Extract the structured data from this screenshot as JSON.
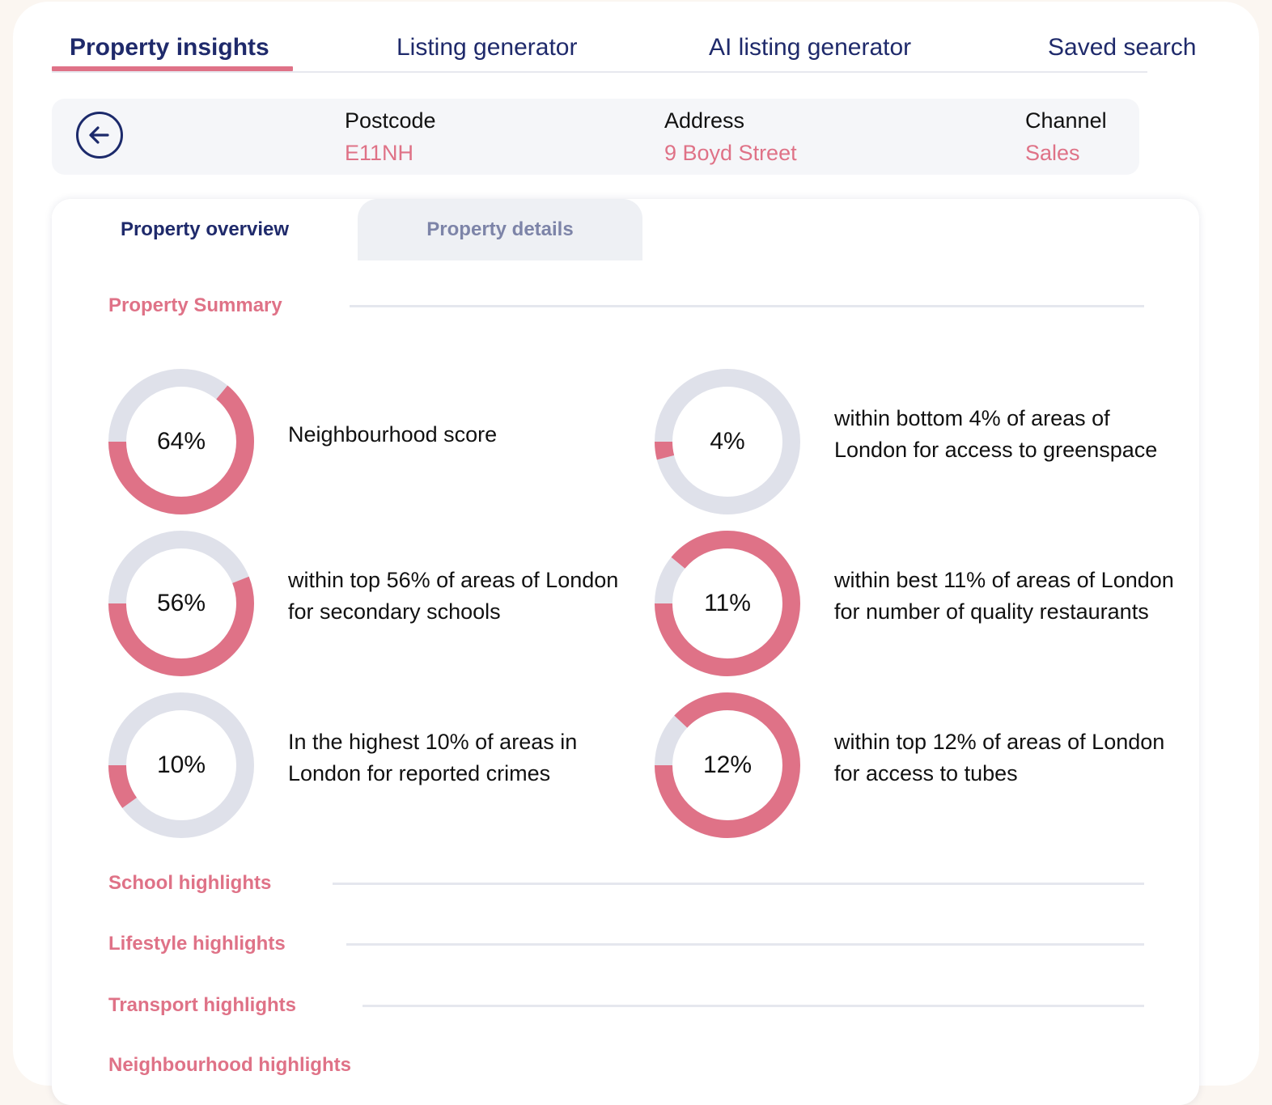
{
  "top_tabs": [
    {
      "label": "Property insights",
      "active": true
    },
    {
      "label": "Listing generator",
      "active": false
    },
    {
      "label": "AI listing generator",
      "active": false
    },
    {
      "label": "Saved search",
      "active": false
    }
  ],
  "info_bar": {
    "back_icon": "arrow-left-circle-icon",
    "postcode_label": "Postcode",
    "postcode_value": "E11NH",
    "address_label": "Address",
    "address_value": "9 Boyd Street",
    "channel_label": "Channel",
    "channel_value": "Sales"
  },
  "sub_tabs": {
    "overview": "Property overview",
    "details": "Property details"
  },
  "sections": {
    "summary": "Property Summary",
    "school": "School highlights",
    "lifestyle": "Lifestyle highlights",
    "transport": "Transport highlights",
    "neighbourhood": "Neighbourhood highlights"
  },
  "colors": {
    "accent": "#df7287",
    "track": "#dfe1ea",
    "navy": "#1f2a6b"
  },
  "metrics": [
    {
      "value_text": "64%",
      "fraction": 0.64,
      "lines": [
        "Neighbourhood score"
      ]
    },
    {
      "value_text": "4%",
      "fraction": 0.04,
      "lines": [
        "within bottom 4% of areas of",
        "London for access to greenspace"
      ]
    },
    {
      "value_text": "56%",
      "fraction": 0.56,
      "lines": [
        "within top 56% of areas of London",
        "for secondary schools"
      ]
    },
    {
      "value_text": "11%",
      "fraction": 0.89,
      "lines": [
        "within best 11% of areas of London",
        "for number of quality restaurants"
      ]
    },
    {
      "value_text": "10%",
      "fraction": 0.1,
      "lines": [
        "In the highest 10% of areas in",
        "London for reported crimes"
      ]
    },
    {
      "value_text": "12%",
      "fraction": 0.88,
      "lines": [
        "within top 12% of areas of London",
        "for access to tubes"
      ]
    }
  ]
}
